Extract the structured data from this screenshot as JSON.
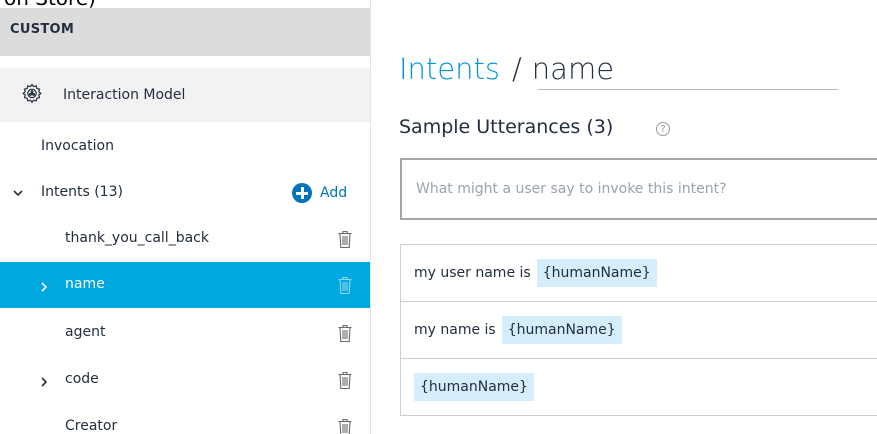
{
  "sidebar": {
    "top_sliver_text": "on Store)",
    "section_header": "CUSTOM",
    "interaction_model_label": "Interaction Model",
    "invocation_label": "Invocation",
    "intents_label": "Intents (13)",
    "add_label": "Add",
    "intents": [
      {
        "label": "thank_you_call_back",
        "expandable": false,
        "selected": false
      },
      {
        "label": "name",
        "expandable": true,
        "selected": true
      },
      {
        "label": "agent",
        "expandable": false,
        "selected": false
      },
      {
        "label": "code",
        "expandable": true,
        "selected": false
      },
      {
        "label": "Creator",
        "expandable": false,
        "selected": false
      }
    ]
  },
  "main": {
    "breadcrumb": {
      "parent": "Intents",
      "separator": "/",
      "current": "name"
    },
    "sample_utterances_title": "Sample Utterances (3)",
    "help_icon": "?",
    "utterance_input": {
      "value": "",
      "placeholder": "What might a user say to invoke this intent?"
    },
    "utterances": [
      {
        "prefix": "my user name is",
        "slot": "{humanName}"
      },
      {
        "prefix": "my name is",
        "slot": "{humanName}"
      },
      {
        "prefix": "",
        "slot": "{humanName}"
      }
    ]
  },
  "colors": {
    "accent": "#00a8e1",
    "link": "#0096d6",
    "add_button": "#0073bb",
    "slot_highlight": "#d4eefb",
    "header_gray": "#dcdcdc"
  }
}
